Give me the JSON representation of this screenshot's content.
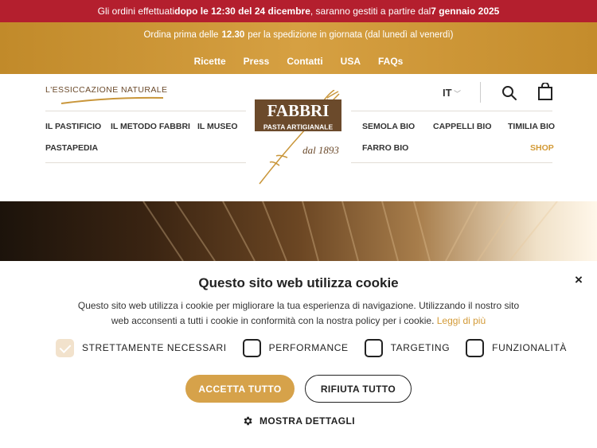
{
  "topbar": {
    "part1": "Gli ordini effettuati ",
    "bold1": "dopo le 12:30 del 24 dicembre",
    "part2": ", saranno gestiti a partire dal ",
    "bold2": "7 gennaio 2025"
  },
  "goldbar": {
    "pre": "Ordina prima delle",
    "time": "12.30",
    "post": "per la spedizione in giornata (dal lunedì al venerdì)",
    "nav": [
      "Ricette",
      "Press",
      "Contatti",
      "USA",
      "FAQs"
    ]
  },
  "header": {
    "tagline": "L'ESSICCAZIONE NATURALE",
    "left_menu": [
      "IL PASTIFICIO",
      "IL METODO FABBRI",
      "IL MUSEO",
      "PASTAPEDIA"
    ],
    "right_menu": [
      "SEMOLA BIO",
      "CAPPELLI BIO",
      "TIMILIA BIO",
      "FARRO BIO",
      "SHOP"
    ],
    "lang": "IT",
    "logo": {
      "brand": "FABBRI",
      "sub": "PASTA ARTIGIANALE",
      "since": "dal 1893"
    },
    "icons": [
      "search-icon",
      "shopping-bag-icon",
      "chevron-down-icon"
    ]
  },
  "cookie": {
    "title": "Questo sito web utilizza cookie",
    "text": "Questo sito web utilizza i cookie per migliorare la tua esperienza di navigazione. Utilizzando il nostro sito web acconsenti a tutti i cookie in conformità con la nostra policy per i cookie.",
    "link": "Leggi di più",
    "close": "×",
    "options": [
      {
        "label": "STRETTAMENTE NECESSARI",
        "checked": true
      },
      {
        "label": "PERFORMANCE",
        "checked": false
      },
      {
        "label": "TARGETING",
        "checked": false
      },
      {
        "label": "FUNZIONALITÀ",
        "checked": false
      }
    ],
    "accept": "ACCETTA TUTTO",
    "reject": "RIFIUTA TUTTO",
    "details": "MOSTRA DETTAGLI"
  },
  "colors": {
    "red": "#b41f2e",
    "gold": "#d6a042",
    "accent": "#d39a36",
    "brand_brown": "#6b4a2b"
  }
}
